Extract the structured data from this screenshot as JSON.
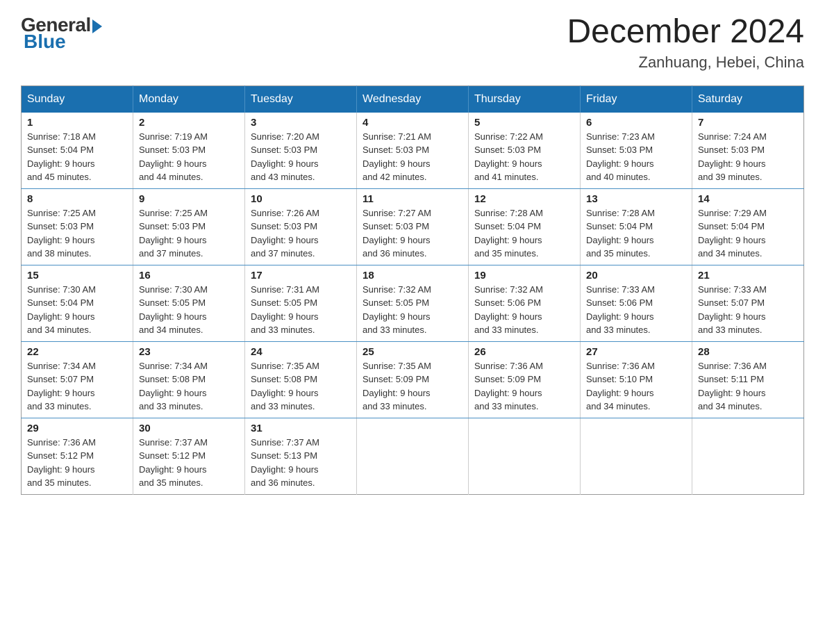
{
  "header": {
    "logo": {
      "general_text": "General",
      "blue_text": "Blue"
    },
    "title": "December 2024",
    "location": "Zanhuang, Hebei, China"
  },
  "calendar": {
    "days_of_week": [
      "Sunday",
      "Monday",
      "Tuesday",
      "Wednesday",
      "Thursday",
      "Friday",
      "Saturday"
    ],
    "weeks": [
      [
        {
          "day": "1",
          "sunrise": "7:18 AM",
          "sunset": "5:04 PM",
          "daylight": "9 hours and 45 minutes."
        },
        {
          "day": "2",
          "sunrise": "7:19 AM",
          "sunset": "5:03 PM",
          "daylight": "9 hours and 44 minutes."
        },
        {
          "day": "3",
          "sunrise": "7:20 AM",
          "sunset": "5:03 PM",
          "daylight": "9 hours and 43 minutes."
        },
        {
          "day": "4",
          "sunrise": "7:21 AM",
          "sunset": "5:03 PM",
          "daylight": "9 hours and 42 minutes."
        },
        {
          "day": "5",
          "sunrise": "7:22 AM",
          "sunset": "5:03 PM",
          "daylight": "9 hours and 41 minutes."
        },
        {
          "day": "6",
          "sunrise": "7:23 AM",
          "sunset": "5:03 PM",
          "daylight": "9 hours and 40 minutes."
        },
        {
          "day": "7",
          "sunrise": "7:24 AM",
          "sunset": "5:03 PM",
          "daylight": "9 hours and 39 minutes."
        }
      ],
      [
        {
          "day": "8",
          "sunrise": "7:25 AM",
          "sunset": "5:03 PM",
          "daylight": "9 hours and 38 minutes."
        },
        {
          "day": "9",
          "sunrise": "7:25 AM",
          "sunset": "5:03 PM",
          "daylight": "9 hours and 37 minutes."
        },
        {
          "day": "10",
          "sunrise": "7:26 AM",
          "sunset": "5:03 PM",
          "daylight": "9 hours and 37 minutes."
        },
        {
          "day": "11",
          "sunrise": "7:27 AM",
          "sunset": "5:03 PM",
          "daylight": "9 hours and 36 minutes."
        },
        {
          "day": "12",
          "sunrise": "7:28 AM",
          "sunset": "5:04 PM",
          "daylight": "9 hours and 35 minutes."
        },
        {
          "day": "13",
          "sunrise": "7:28 AM",
          "sunset": "5:04 PM",
          "daylight": "9 hours and 35 minutes."
        },
        {
          "day": "14",
          "sunrise": "7:29 AM",
          "sunset": "5:04 PM",
          "daylight": "9 hours and 34 minutes."
        }
      ],
      [
        {
          "day": "15",
          "sunrise": "7:30 AM",
          "sunset": "5:04 PM",
          "daylight": "9 hours and 34 minutes."
        },
        {
          "day": "16",
          "sunrise": "7:30 AM",
          "sunset": "5:05 PM",
          "daylight": "9 hours and 34 minutes."
        },
        {
          "day": "17",
          "sunrise": "7:31 AM",
          "sunset": "5:05 PM",
          "daylight": "9 hours and 33 minutes."
        },
        {
          "day": "18",
          "sunrise": "7:32 AM",
          "sunset": "5:05 PM",
          "daylight": "9 hours and 33 minutes."
        },
        {
          "day": "19",
          "sunrise": "7:32 AM",
          "sunset": "5:06 PM",
          "daylight": "9 hours and 33 minutes."
        },
        {
          "day": "20",
          "sunrise": "7:33 AM",
          "sunset": "5:06 PM",
          "daylight": "9 hours and 33 minutes."
        },
        {
          "day": "21",
          "sunrise": "7:33 AM",
          "sunset": "5:07 PM",
          "daylight": "9 hours and 33 minutes."
        }
      ],
      [
        {
          "day": "22",
          "sunrise": "7:34 AM",
          "sunset": "5:07 PM",
          "daylight": "9 hours and 33 minutes."
        },
        {
          "day": "23",
          "sunrise": "7:34 AM",
          "sunset": "5:08 PM",
          "daylight": "9 hours and 33 minutes."
        },
        {
          "day": "24",
          "sunrise": "7:35 AM",
          "sunset": "5:08 PM",
          "daylight": "9 hours and 33 minutes."
        },
        {
          "day": "25",
          "sunrise": "7:35 AM",
          "sunset": "5:09 PM",
          "daylight": "9 hours and 33 minutes."
        },
        {
          "day": "26",
          "sunrise": "7:36 AM",
          "sunset": "5:09 PM",
          "daylight": "9 hours and 33 minutes."
        },
        {
          "day": "27",
          "sunrise": "7:36 AM",
          "sunset": "5:10 PM",
          "daylight": "9 hours and 34 minutes."
        },
        {
          "day": "28",
          "sunrise": "7:36 AM",
          "sunset": "5:11 PM",
          "daylight": "9 hours and 34 minutes."
        }
      ],
      [
        {
          "day": "29",
          "sunrise": "7:36 AM",
          "sunset": "5:12 PM",
          "daylight": "9 hours and 35 minutes."
        },
        {
          "day": "30",
          "sunrise": "7:37 AM",
          "sunset": "5:12 PM",
          "daylight": "9 hours and 35 minutes."
        },
        {
          "day": "31",
          "sunrise": "7:37 AM",
          "sunset": "5:13 PM",
          "daylight": "9 hours and 36 minutes."
        },
        null,
        null,
        null,
        null
      ]
    ],
    "labels": {
      "sunrise": "Sunrise:",
      "sunset": "Sunset:",
      "daylight": "Daylight:"
    }
  }
}
